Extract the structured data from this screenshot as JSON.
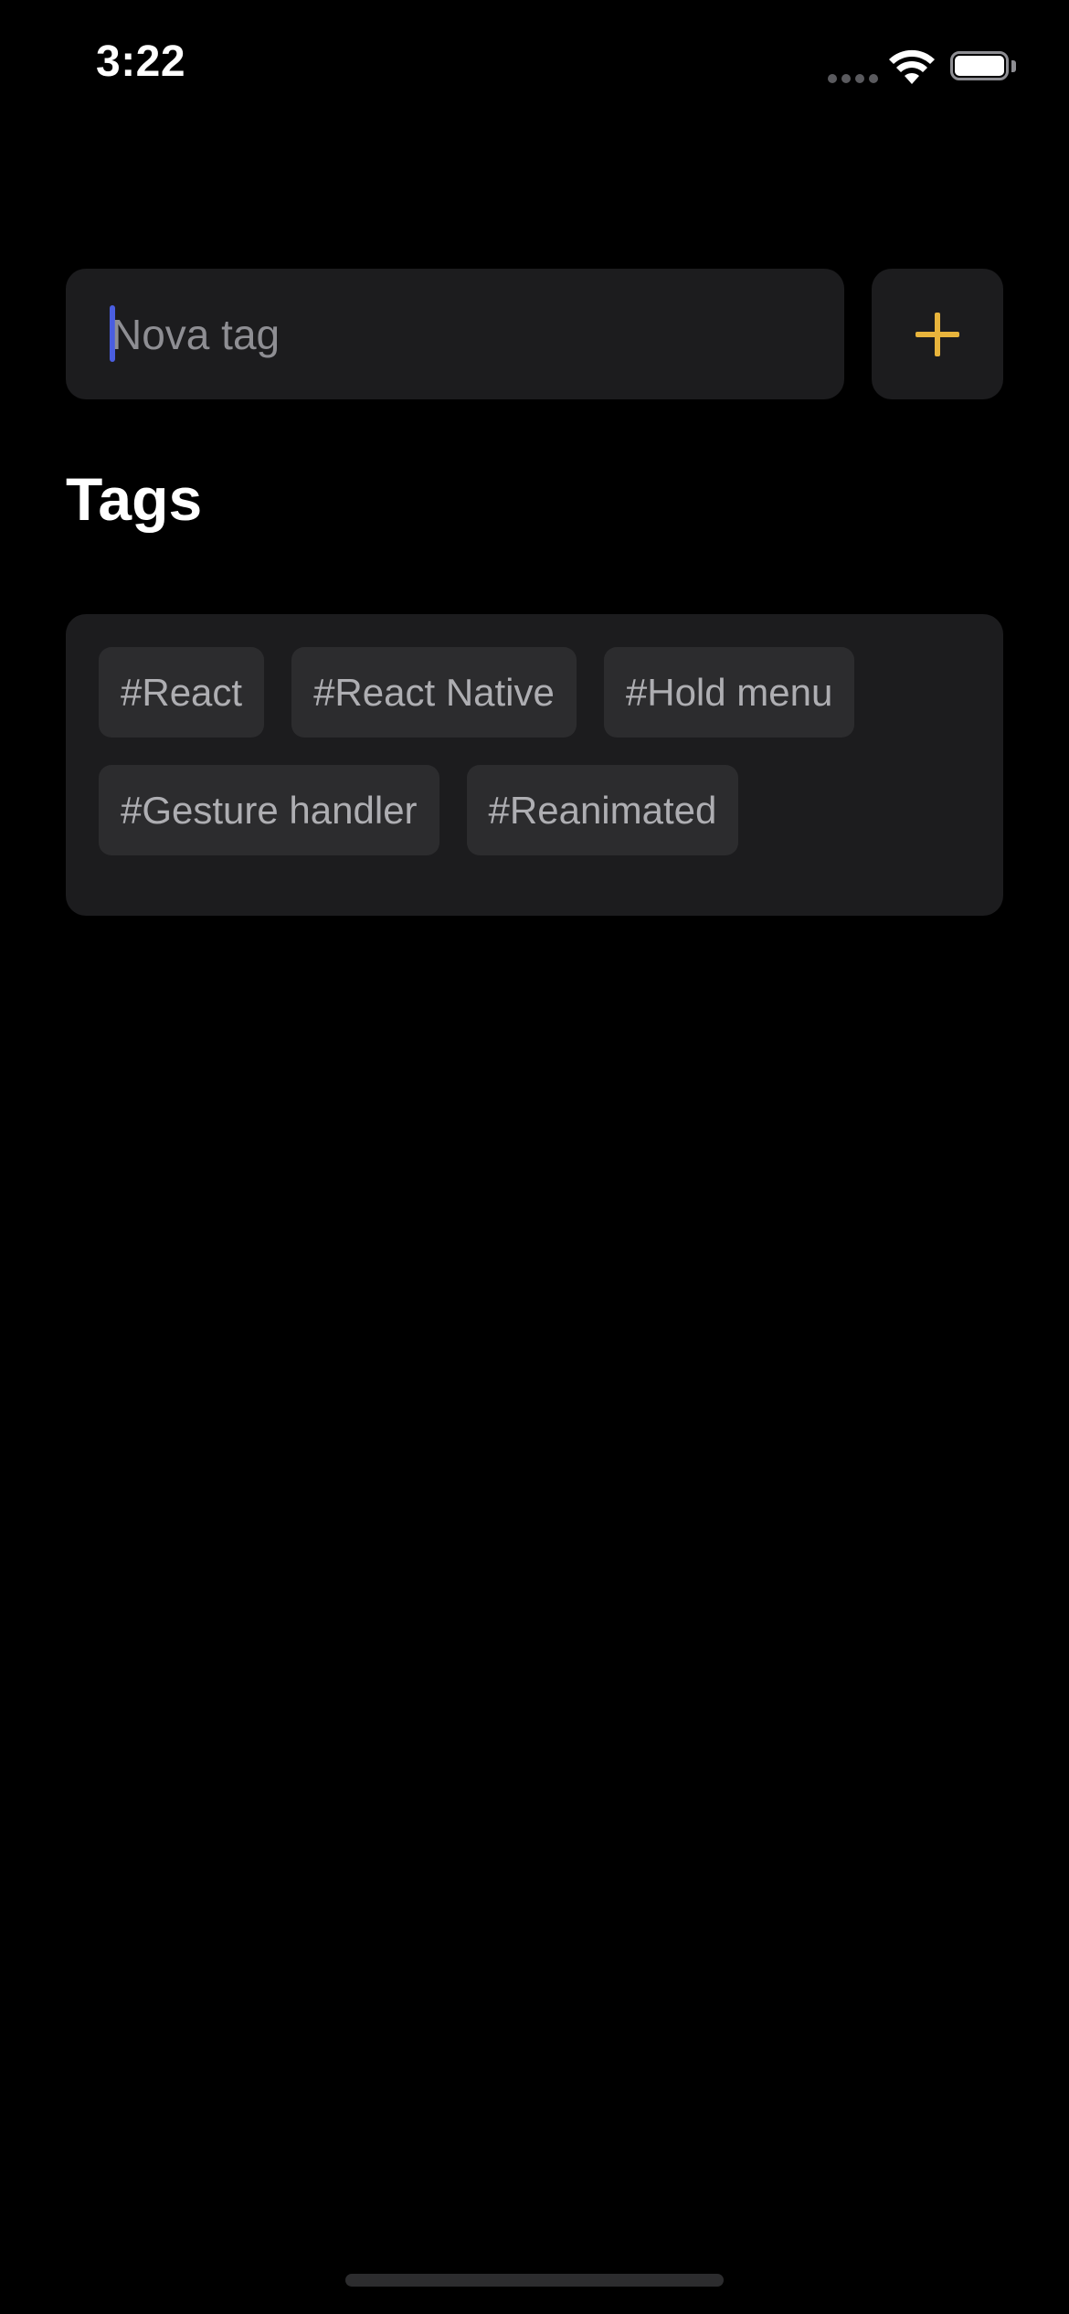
{
  "status_bar": {
    "time": "3:22"
  },
  "new_tag": {
    "placeholder": "Nova tag",
    "value": "",
    "add_icon": "plus-icon",
    "accent_color": "#e8b43c"
  },
  "tags_section": {
    "title": "Tags",
    "tags": [
      {
        "label": "#React"
      },
      {
        "label": "#React Native"
      },
      {
        "label": "#Hold menu"
      },
      {
        "label": "#Gesture handler"
      },
      {
        "label": "#Reanimated"
      }
    ]
  },
  "colors": {
    "background": "#000000",
    "surface": "#1c1c1e",
    "chip": "#2c2c2e",
    "chip_text": "#aeaeb2",
    "caret": "#4a5ee0"
  }
}
